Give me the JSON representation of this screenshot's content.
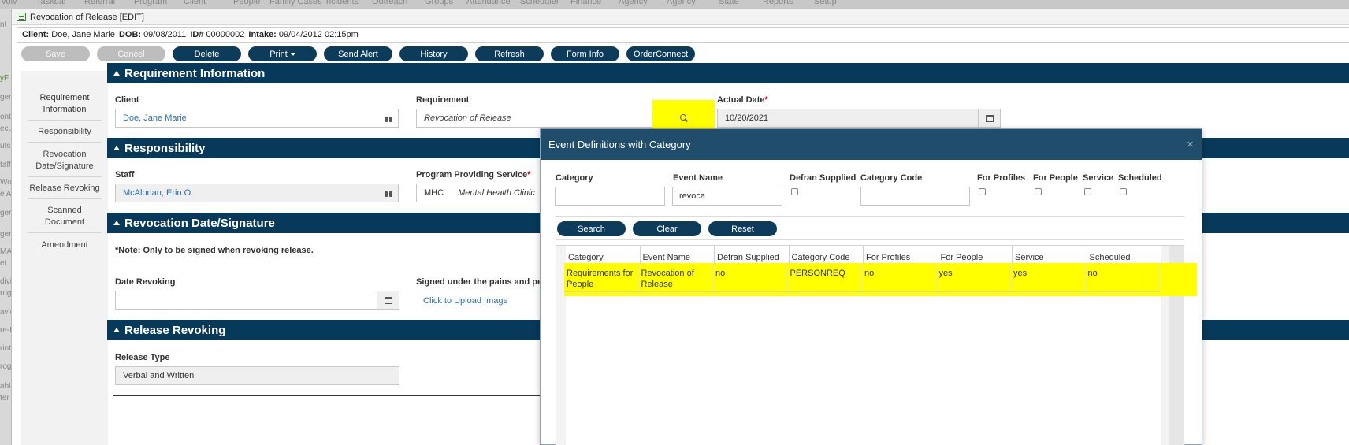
{
  "background_menu": [
    "volv",
    "Taskbar",
    "Referral",
    "Program",
    "Client",
    "People",
    "Family Cases",
    "Incidents",
    "Outreach",
    "Groups",
    "Attendance",
    "Scheduler",
    "Finance",
    "Agency",
    "Agency",
    "State",
    "Reports",
    "Setup"
  ],
  "background_left": [
    "nt",
    "yF",
    "ger",
    "ont",
    "ecu",
    "uts",
    "taff",
    "Work",
    "e Al",
    "ger",
    "ger",
    "MAI",
    "et",
    "divi",
    "rog",
    "avio",
    "re-F",
    "rint",
    "rog",
    "able",
    "ter"
  ],
  "window": {
    "title": "Revocation of Release [EDIT]"
  },
  "client_bar": {
    "client_label": "Client:",
    "client_value": "Doe, Jane Marie",
    "dob_label": "DOB:",
    "dob_value": "09/08/2011",
    "id_label": "ID#",
    "id_value": "00000002",
    "intake_label": "Intake:",
    "intake_value": "09/04/2012 02:15pm"
  },
  "toolbar": {
    "save": "Save",
    "cancel": "Cancel",
    "delete": "Delete",
    "print": "Print",
    "send_alert": "Send Alert",
    "history": "History",
    "refresh": "Refresh",
    "form_info": "Form Info",
    "orderconnect": "OrderConnect"
  },
  "sidenav": {
    "requirement_information": "Requirement Information",
    "responsibility": "Responsibility",
    "revocation_date_signature": "Revocation Date/Signature",
    "release_revoking": "Release Revoking",
    "scanned_document": "Scanned Document",
    "amendment": "Amendment"
  },
  "sections": {
    "requirement_information": "Requirement Information",
    "responsibility": "Responsibility",
    "revocation_date_signature": "Revocation Date/Signature",
    "release_revoking": "Release Revoking"
  },
  "requirement": {
    "client_label": "Client",
    "client_value": "Doe, Jane Marie",
    "requirement_label": "Requirement",
    "requirement_value": "Revocation of Release",
    "actual_date_label": "Actual Date",
    "actual_date_value": "10/20/2021",
    "required_mark": "*"
  },
  "responsibility": {
    "staff_label": "Staff",
    "staff_value": "McAlonan, Erin O.",
    "program_label": "Program Providing Service",
    "program_code": "MHC",
    "program_name": "Mental Health Clinic",
    "required_mark": "*"
  },
  "revocation": {
    "note": "*Note: Only to be signed when revoking release.",
    "date_label": "Date Revoking",
    "date_value": "",
    "signed_label": "Signed under the pains and pena",
    "upload_link": "Click to Upload Image"
  },
  "release": {
    "release_type_label": "Release Type",
    "release_type_value": "Verbal and Written"
  },
  "modal": {
    "title": "Event Definitions with Category",
    "close": "×",
    "filters": {
      "category_label": "Category",
      "category_value": "",
      "event_name_label": "Event Name",
      "event_name_value": "revoca",
      "defran_label": "Defran Supplied",
      "category_code_label": "Category Code",
      "category_code_value": "",
      "for_profiles_label": "For Profiles",
      "for_people_label": "For People",
      "service_label": "Service",
      "scheduled_label": "Scheduled"
    },
    "buttons": {
      "search": "Search",
      "clear": "Clear",
      "reset": "Reset"
    },
    "grid": {
      "columns": [
        "Category",
        "Event Name",
        "Defran Supplied",
        "Category Code",
        "For Profiles",
        "For People",
        "Service",
        "Scheduled"
      ],
      "rows": [
        [
          "Requirements for People",
          "Revocation of Release",
          "no",
          "PERSONREQ",
          "no",
          "yes",
          "yes",
          "no"
        ]
      ]
    }
  },
  "colors": {
    "header_navy": "#073a5a",
    "modal_header": "#1f4d6b",
    "highlight": "#ffff00",
    "link": "#2a6db0"
  }
}
